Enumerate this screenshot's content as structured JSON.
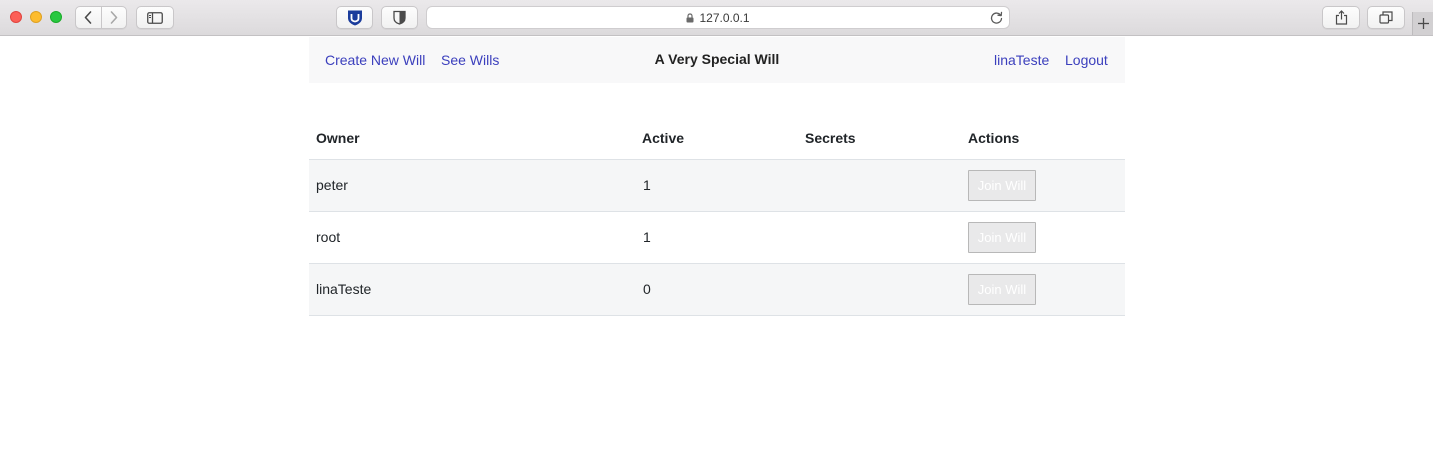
{
  "browser": {
    "address": "127.0.0.1",
    "icons": {
      "back": "chevron-left-icon",
      "forward": "chevron-right-icon",
      "sidebar": "sidebar-icon",
      "extension1": "shield-extension-icon",
      "extension2": "privacy-shield-icon",
      "lock": "lock-icon",
      "reload": "reload-icon",
      "share": "share-icon",
      "tabs": "tabs-overview-icon",
      "new_tab": "plus-icon"
    }
  },
  "navbar": {
    "create_label": "Create New Will",
    "see_label": "See Wills",
    "brand": "A Very Special Will",
    "user_label": "linaTeste",
    "logout_label": "Logout",
    "link_color": "#3b3fbd"
  },
  "table": {
    "headers": {
      "owner": "Owner",
      "active": "Active",
      "secrets": "Secrets",
      "actions": "Actions"
    },
    "rows": [
      {
        "owner": "peter",
        "active": "1",
        "secrets": "",
        "action_label": "Join Will"
      },
      {
        "owner": "root",
        "active": "1",
        "secrets": "",
        "action_label": "Join Will"
      },
      {
        "owner": "linaTeste",
        "active": "0",
        "secrets": "",
        "action_label": "Join Will"
      }
    ]
  }
}
